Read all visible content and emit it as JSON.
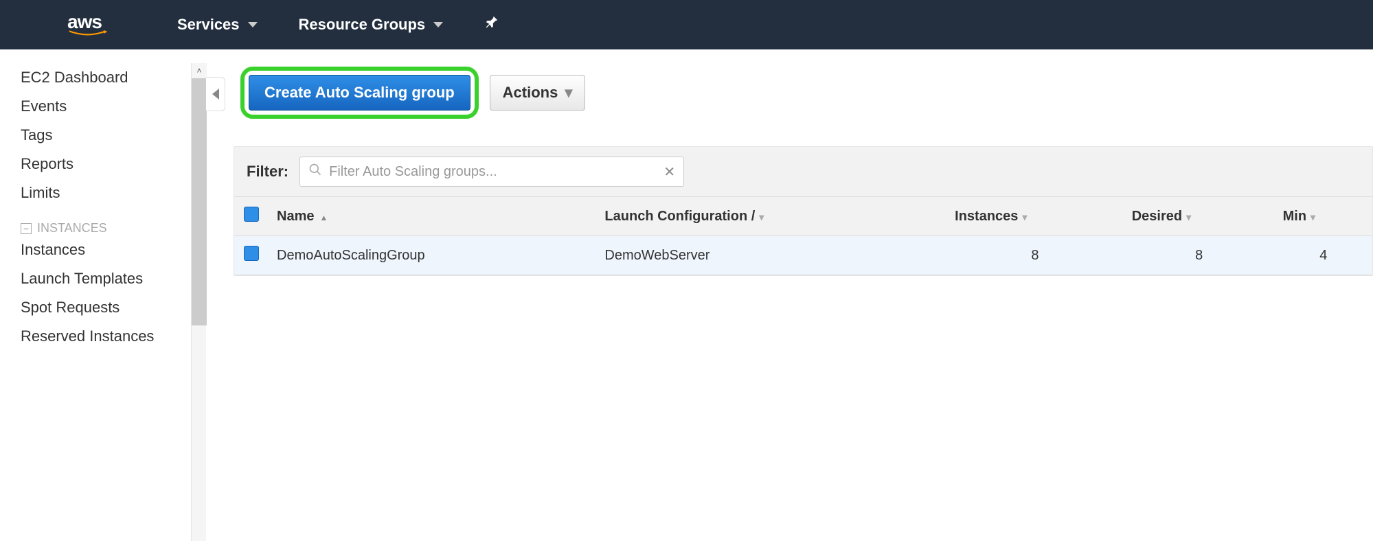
{
  "header": {
    "logo_text": "aws",
    "nav": {
      "services": "Services",
      "resource_groups": "Resource Groups"
    }
  },
  "sidebar": {
    "links_top": [
      "EC2 Dashboard",
      "Events",
      "Tags",
      "Reports",
      "Limits"
    ],
    "section_instances": "INSTANCES",
    "instances_links": [
      "Instances",
      "Launch Templates",
      "Spot Requests",
      "Reserved Instances"
    ]
  },
  "toolbar": {
    "create_label": "Create Auto Scaling group",
    "actions_label": "Actions"
  },
  "filter": {
    "label": "Filter:",
    "placeholder": "Filter Auto Scaling groups..."
  },
  "table": {
    "columns": [
      "Name",
      "Launch Configuration /",
      "Instances",
      "Desired",
      "Min"
    ],
    "rows": [
      {
        "name": "DemoAutoScalingGroup",
        "launch_config": "DemoWebServer",
        "instances": "8",
        "desired": "8",
        "min": "4"
      }
    ]
  }
}
